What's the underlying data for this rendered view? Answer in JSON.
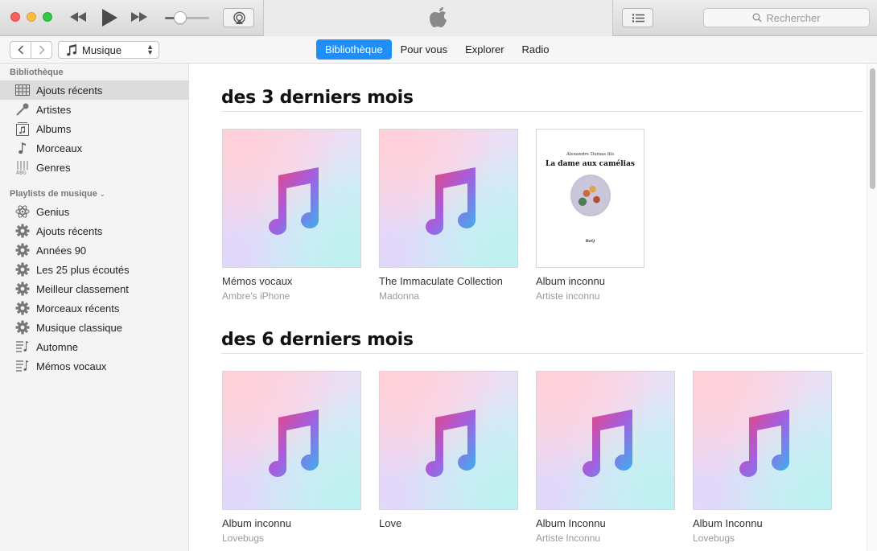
{
  "toolbar": {
    "search_placeholder": "Rechercher",
    "volume_level": 0.35
  },
  "navbar": {
    "media_selector": "Musique",
    "tabs": [
      {
        "label": "Bibliothèque",
        "active": true
      },
      {
        "label": "Pour vous",
        "active": false
      },
      {
        "label": "Explorer",
        "active": false
      },
      {
        "label": "Radio",
        "active": false
      }
    ]
  },
  "sidebar": {
    "library_header": "Bibliothèque",
    "library_items": [
      {
        "label": "Ajouts récents",
        "icon": "grid-icon",
        "selected": true
      },
      {
        "label": "Artistes",
        "icon": "microphone-icon"
      },
      {
        "label": "Albums",
        "icon": "album-icon"
      },
      {
        "label": "Morceaux",
        "icon": "music-note-icon"
      },
      {
        "label": "Genres",
        "icon": "guitar-icon"
      }
    ],
    "playlists_header": "Playlists de musique",
    "playlist_items": [
      {
        "label": "Genius",
        "icon": "genius-atom-icon"
      },
      {
        "label": "Ajouts récents",
        "icon": "gear-icon"
      },
      {
        "label": "Années 90",
        "icon": "gear-icon"
      },
      {
        "label": "Les 25 plus écoutés",
        "icon": "gear-icon"
      },
      {
        "label": "Meilleur classement",
        "icon": "gear-icon"
      },
      {
        "label": "Morceaux récents",
        "icon": "gear-icon"
      },
      {
        "label": "Musique classique",
        "icon": "gear-icon"
      },
      {
        "label": "Automne",
        "icon": "playlist-icon"
      },
      {
        "label": "Mémos vocaux",
        "icon": "playlist-icon"
      }
    ]
  },
  "main": {
    "sections": [
      {
        "title": "des 3 derniers mois",
        "albums": [
          {
            "title": "Mémos vocaux",
            "artist": "Ambre's iPhone",
            "art": "music-placeholder"
          },
          {
            "title": "The Immaculate Collection",
            "artist": "Madonna",
            "art": "music-placeholder"
          },
          {
            "title": "Album inconnu",
            "artist": "Artiste inconnu",
            "art": "book-cover",
            "cover_author": "Alexandre Dumas fils",
            "cover_title": "La dame aux camélias",
            "cover_publisher": "BeQ"
          }
        ]
      },
      {
        "title": "des 6 derniers mois",
        "albums": [
          {
            "title": "Album inconnu",
            "artist": "Lovebugs",
            "art": "music-placeholder"
          },
          {
            "title": "Love",
            "artist": "",
            "art": "music-placeholder"
          },
          {
            "title": "Album Inconnu",
            "artist": "Artiste Inconnu",
            "art": "music-placeholder"
          },
          {
            "title": "Album Inconnu",
            "artist": "Lovebugs",
            "art": "music-placeholder"
          }
        ]
      }
    ]
  },
  "colors": {
    "accent": "#1f8ef9",
    "close": "#fc605c",
    "minimize": "#fdbc40",
    "maximize": "#34c84a"
  }
}
